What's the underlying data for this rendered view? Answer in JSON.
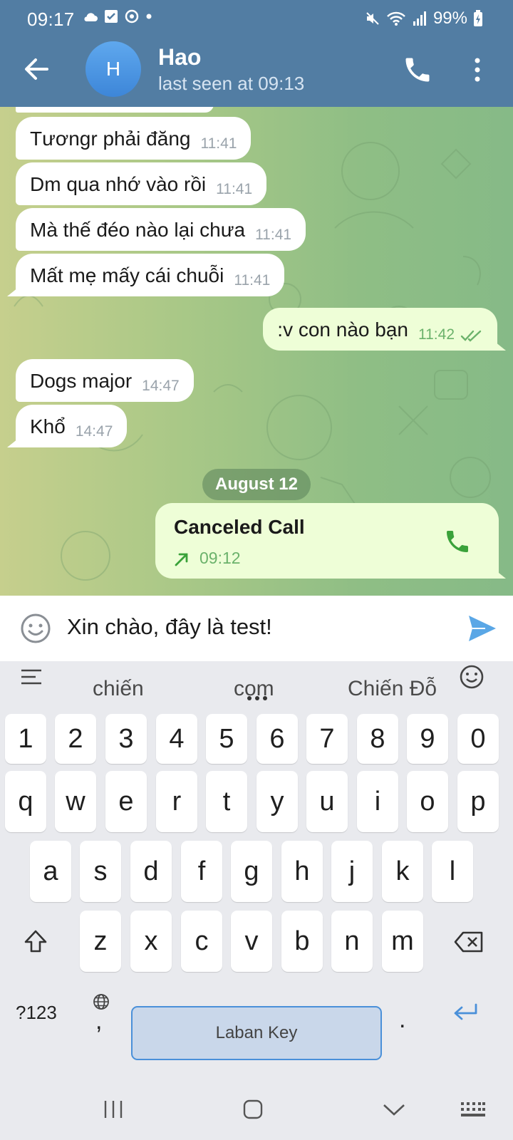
{
  "status_bar": {
    "time": "09:17",
    "battery": "99%"
  },
  "header": {
    "avatar_letter": "H",
    "name": "Hao",
    "last_seen": "last seen at 09:13"
  },
  "messages": [
    {
      "text": "Tươngr phải đăng",
      "time": "11:41",
      "dir": "in"
    },
    {
      "text": "Dm qua nhớ vào rồi",
      "time": "11:41",
      "dir": "in"
    },
    {
      "text": "Mà thế đéo nào lại chưa",
      "time": "11:41",
      "dir": "in"
    },
    {
      "text": "Mất mẹ mấy cái chuỗi",
      "time": "11:41",
      "dir": "in"
    },
    {
      "text": ":v con nào bạn",
      "time": "11:42",
      "dir": "out"
    },
    {
      "text": "Dogs major",
      "time": "14:47",
      "dir": "in"
    },
    {
      "text": "Khổ",
      "time": "14:47",
      "dir": "in"
    }
  ],
  "date_chip": "August 12",
  "call": {
    "title": "Canceled Call",
    "time": "09:12"
  },
  "composer": {
    "text": "Xin chào, đây là test!"
  },
  "keyboard": {
    "suggestions": [
      "chiến",
      "com",
      "Chiến Đỗ"
    ],
    "number_row": [
      "1",
      "2",
      "3",
      "4",
      "5",
      "6",
      "7",
      "8",
      "9",
      "0"
    ],
    "row1": [
      "q",
      "w",
      "e",
      "r",
      "t",
      "y",
      "u",
      "i",
      "o",
      "p"
    ],
    "row2": [
      "a",
      "s",
      "d",
      "f",
      "g",
      "h",
      "j",
      "k",
      "l"
    ],
    "row3": [
      "z",
      "x",
      "c",
      "v",
      "b",
      "n",
      "m"
    ],
    "mode_key": "?123",
    "comma": ",",
    "space_label": "Laban Key",
    "period": "."
  },
  "colors": {
    "header": "#527da3",
    "outgoing_bubble": "#eefed7",
    "incoming_bubble": "#ffffff",
    "accent_green": "#3aa23a",
    "send_blue": "#5aa7e6"
  }
}
